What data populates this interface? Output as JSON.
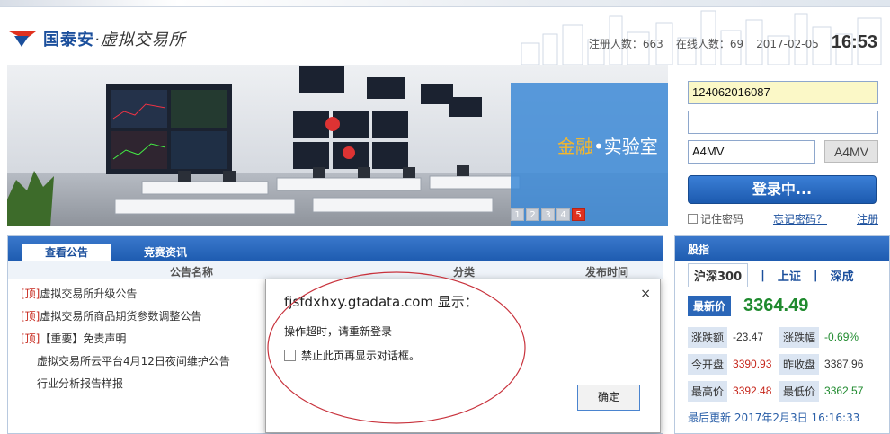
{
  "header": {
    "logo_brand": "国泰安",
    "logo_sub": "·虚拟交易所",
    "registered": "注册人数：663",
    "online": "在线人数：69",
    "date": "2017-02-05",
    "time": "16:53"
  },
  "banner": {
    "title_a": "金融",
    "title_b": "•实验室",
    "pages": [
      "1",
      "2",
      "3",
      "4",
      "5"
    ],
    "active_page": "5"
  },
  "login": {
    "username_value": "124062016087",
    "password_value": "",
    "captcha_value": "A4MV",
    "captcha_image_text": "A4MV",
    "submit_label": "登录中...",
    "remember_label": "记住密码",
    "forgot_label": "忘记密码？",
    "register_label": "注册"
  },
  "notice": {
    "tabs": [
      "查看公告",
      "竞赛资讯"
    ],
    "col_name": "公告名称",
    "col_category": "分类",
    "col_time": "发布时间",
    "items": [
      {
        "tag": "[顶]",
        "text": "虚拟交易所升级公告"
      },
      {
        "tag": "[顶]",
        "text": "虚拟交易所商品期货参数调整公告"
      },
      {
        "tag": "[顶]",
        "text": "【重要】免责声明"
      },
      {
        "tag": "",
        "text": "虚拟交易所云平台4月12日夜间维护公告"
      },
      {
        "tag": "",
        "text": "行业分析报告样报"
      }
    ]
  },
  "index": {
    "title": "股指",
    "tabs": [
      "沪深300",
      "上证",
      "深成"
    ],
    "separator": "|",
    "latest_label": "最新价",
    "latest_value": "3364.49",
    "rows": [
      {
        "k1": "涨跌额",
        "v1": "-23.47",
        "k2": "涨跌幅",
        "v2": "-0.69%"
      },
      {
        "k1": "今开盘",
        "v1": "3390.93",
        "k2": "昨收盘",
        "v2": "3387.96"
      },
      {
        "k1": "最高价",
        "v1": "3392.48",
        "k2": "最低价",
        "v2": "3362.57"
      }
    ],
    "updated": "最后更新 2017年2月3日 16:16:33"
  },
  "dialog": {
    "title": "fjsfdxhxy.gtadata.com 显示：",
    "message": "操作超时，请重新登录",
    "checkbox_label": "禁止此页再显示对话框。",
    "ok_label": "确定",
    "close_glyph": "×"
  },
  "colors": {
    "brand_blue": "#1b4f9c",
    "header_blue": "#2a66b8",
    "up_red": "#c6261b",
    "down_green": "#1f8a2e",
    "annotation_red": "#c8323c"
  }
}
